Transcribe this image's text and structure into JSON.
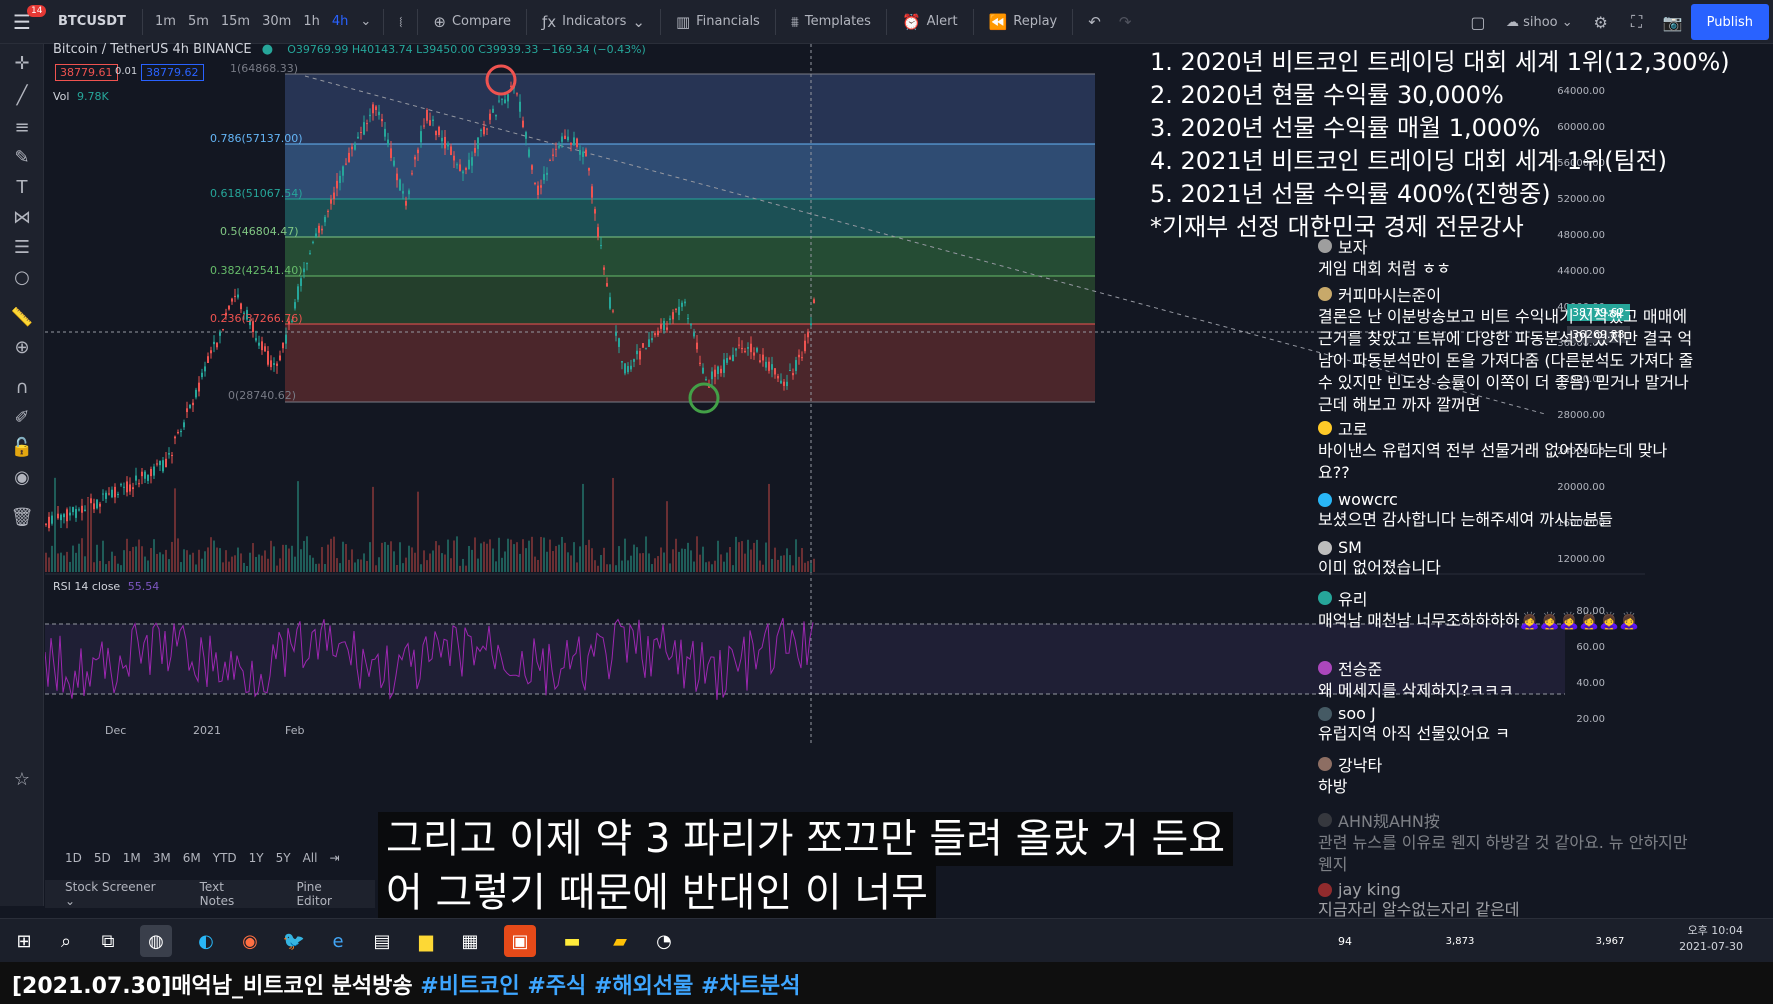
{
  "toolbar": {
    "badge": "14",
    "symbol": "BTCUSDT",
    "timeframes": [
      "1m",
      "5m",
      "15m",
      "30m",
      "1h",
      "4h"
    ],
    "active_timeframe": "4h",
    "compare": "Compare",
    "indicators": "Indicators",
    "financials": "Financials",
    "templates": "Templates",
    "alert": "Alert",
    "replay": "Replay",
    "user": "sihoo",
    "publish": "Publish"
  },
  "chart": {
    "title": "Bitcoin / TetherUS  4h  BINANCE",
    "ohlc": "O39769.99 H40143.74 L39450.00 C39939.33 −169.34 (−0.43%)",
    "bid": "38779.61",
    "spread": "0.01",
    "ask": "38779.62",
    "vol_label": "Vol",
    "vol_value": "9.78K",
    "rsi_label": "RSI 14 close",
    "rsi_value": "55.54",
    "fib_levels": [
      {
        "label": "1(64868.33)",
        "color": "#787b86"
      },
      {
        "label": "0.786(57137.00)",
        "color": "#64b5f6"
      },
      {
        "label": "0.618(51067.54)",
        "color": "#26a69a"
      },
      {
        "label": "0.5(46804.47)",
        "color": "#81c784"
      },
      {
        "label": "0.382(42541.40)",
        "color": "#66bb6a"
      },
      {
        "label": "0.236(37266.76)",
        "color": "#ef5350"
      },
      {
        "label": "0(28740.62)",
        "color": "#787b86"
      }
    ],
    "yaxis": [
      "64000.00",
      "60000.00",
      "56000.00",
      "52000.00",
      "48000.00",
      "44000.00",
      "40000.00",
      "36000.00",
      "32000.00",
      "28000.00",
      "24000.00",
      "20000.00",
      "16000.00",
      "12000.00"
    ],
    "rsi_axis": [
      "80.00",
      "60.00",
      "40.00",
      "20.00"
    ],
    "price_tags": [
      "38779.62",
      "36269.88"
    ],
    "xaxis": [
      "Dec",
      "2021",
      "Feb"
    ]
  },
  "achievements": [
    "1. 2020년 비트코인 트레이딩 대회 세계 1위(12,300%)",
    "2. 2020년 현물 수익률 30,000%",
    "3. 2020년 선물 수익률 매월 1,000%",
    "4. 2021년 비트코인 트레이딩 대회 세계 1위(팀전)",
    "5. 2021년 선물 수익률 400%(진행중)",
    "*기재부 선정 대한민국 경제 전문강사"
  ],
  "chat": [
    {
      "author": "보자",
      "text": "게임 대회 처럼 ㅎㅎ",
      "color": "#9e9e9e"
    },
    {
      "author": "커피마시는준이",
      "text": "결론은 난 이분방송보고 비트 수익내기 시작했고 매매에 근거를 찾았고 트뷰에 다양한 파동분석이 있지만 결국 억남이 파동분석만이 돈을 가져다줌 (다른분석도 가져다 줄 수 있지만 빈도상 승률이 이쪽이 더 좋음) 믿거나 말거나 근데 해보고 까자 깔꺼면",
      "color": "#c8a96a"
    },
    {
      "author": "고로",
      "text": "바이낸스 유럽지역 전부 선물거래 없어진다는데 맞나요??",
      "color": "#ffca28"
    },
    {
      "author": "wowcrc",
      "text": "보셨으면 감사합니다 는해주세여 까시는분들",
      "color": "#29b6f6"
    },
    {
      "author": "SM",
      "text": "이미 없어졌습니다",
      "color": "#bdbdbd"
    },
    {
      "author": "유리",
      "text": "매억남 매천남 너무조하하하하🙇‍♀️🙇‍♀️🙇‍♀️🙇‍♀️🙇‍♀️🙇‍♀️",
      "color": "#26a69a"
    },
    {
      "author": "전승준",
      "text": "왜 메세지를 삭제하지?ㅋㅋㅋ",
      "color": "#ab47bc"
    },
    {
      "author": "soo J",
      "text": "유럽지역 아직 선물있어요 ㅋ",
      "color": "#455a64"
    },
    {
      "author": "강낙타",
      "text": "하방",
      "color": "#8d6e63"
    },
    {
      "author": "AHN规AHN按",
      "text": "관련 뉴스를 이유로 웬지 하방갈 것 같아요. 뉴 안하지만 웬지",
      "color": "#616161"
    },
    {
      "author": "jay king",
      "text": "지금자리 알수없는자리 같은데",
      "color": "#e53935"
    }
  ],
  "ranges": [
    "1D",
    "5D",
    "1M",
    "3M",
    "6M",
    "YTD",
    "1Y",
    "5Y",
    "All"
  ],
  "bottom_tabs": [
    "Stock Screener",
    "Text Notes",
    "Pine Editor"
  ],
  "subtitles": [
    "그리고 이제 약 3 파리가 쪼끄만 들려 올랐 거 든요",
    "어 그렇기 때문에 반대인 이 너무"
  ],
  "taskbar": {
    "time": "오후 10:04",
    "date": "2021-07-30",
    "counts": [
      "94",
      "3,873",
      "3,967"
    ]
  },
  "video_title": {
    "text": "[2021.07.30]매억남_비트코인 분석방송",
    "tags": [
      "#비트코인",
      "#주식",
      "#해외선물",
      "#차트분석"
    ]
  }
}
